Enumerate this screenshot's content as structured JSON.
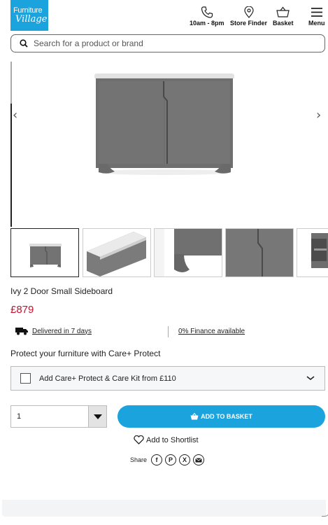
{
  "brand": {
    "line1": "Furniture",
    "line2": "Village"
  },
  "header": {
    "phone_label": "10am - 8pm",
    "store_label": "Store Finder",
    "basket_label": "Basket",
    "menu_label": "Menu"
  },
  "search": {
    "placeholder": "Search for a product or brand"
  },
  "product": {
    "title": "Ivy 2 Door Small Sideboard",
    "price": "£879",
    "delivery": "Delivered in 7 days",
    "finance": "0% Finance available"
  },
  "protect": {
    "heading": "Protect your furniture with Care+ Protect",
    "option_label": "Add Care+ Protect & Care Kit from £110"
  },
  "purchase": {
    "quantity": "1",
    "add_label": "ADD TO BASKET",
    "shortlist_label": "Add to Shortlist",
    "share_label": "Share"
  },
  "colors": {
    "brand_blue": "#1aa3dc",
    "price_red": "#c8102e"
  }
}
